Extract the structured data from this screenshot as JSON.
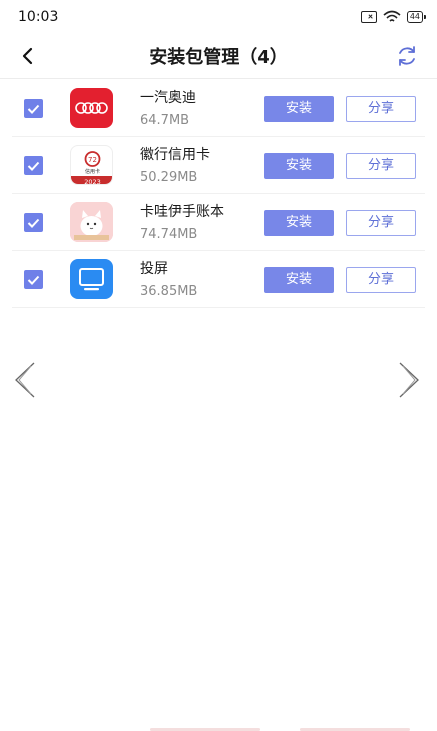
{
  "status_bar": {
    "time": "10:03",
    "battery": "44"
  },
  "header": {
    "title": "安装包管理（4）"
  },
  "apps": [
    {
      "name": "一汽奥迪",
      "size": "64.7MB",
      "checked": true,
      "icon": "audi-rings-icon",
      "icon_color": "#e3202f"
    },
    {
      "name": "徽行信用卡",
      "size": "50.29MB",
      "checked": true,
      "icon": "huishang-credit-card-icon",
      "icon_color": "#c82d2d",
      "icon_text": [
        "信用卡",
        "2023"
      ]
    },
    {
      "name": "卡哇伊手账本",
      "size": "74.74MB",
      "checked": true,
      "icon": "kawaii-cat-icon",
      "icon_color": "#f7c7c9"
    },
    {
      "name": "投屏",
      "size": "36.85MB",
      "checked": true,
      "icon": "screen-cast-icon",
      "icon_color": "#2a8bf2"
    }
  ],
  "actions": {
    "install_label": "安装",
    "share_label": "分享"
  },
  "colors": {
    "accent": "#7887e8",
    "checkbox": "#6f80e8",
    "share_border": "#9aa6ee"
  }
}
